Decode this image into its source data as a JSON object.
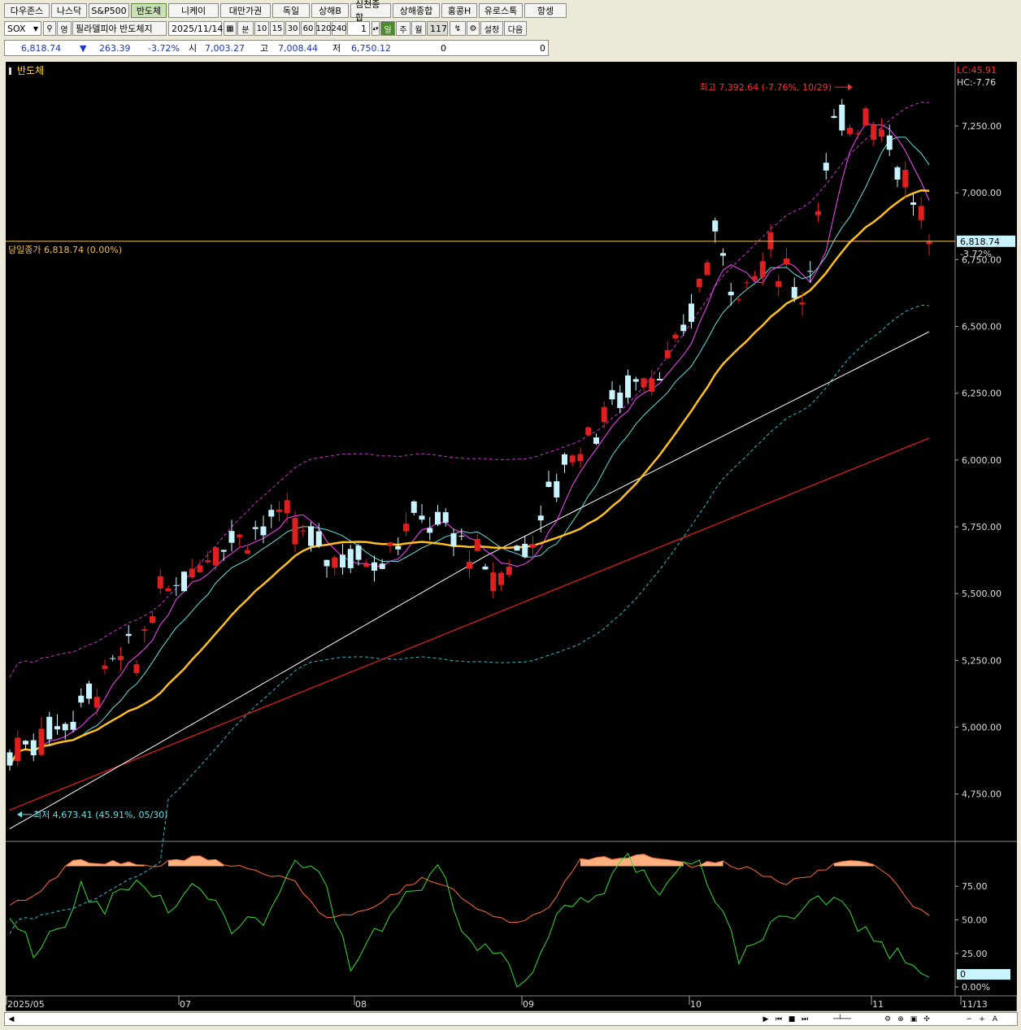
{
  "market_tabs": [
    "다우존스",
    "나스닥",
    "S&P500",
    "반도체",
    "니케이",
    "대만가권",
    "독일",
    "상해B",
    "심천종합",
    "상해종합",
    "홍콩H",
    "유로스톡",
    "항셍"
  ],
  "active_tab_index": 3,
  "toolbar": {
    "symbol": "SOX",
    "mode": "영",
    "name": "필라델피아 반도체지",
    "date": "2025/11/14",
    "minute_label": "분",
    "intervals": [
      "10",
      "15",
      "30",
      "60",
      "120",
      "240"
    ],
    "unit": "1",
    "day_label": "일",
    "week_label": "주",
    "month_label": "월",
    "count": "117",
    "settings_label": "설정",
    "next_label": "다음"
  },
  "quote": {
    "price": "6,818.74",
    "arrow": "▼",
    "change": "263.39",
    "pct": "-3.72%",
    "open_label": "시",
    "open": "7,003.27",
    "high_label": "고",
    "high": "7,008.44",
    "low_label": "저",
    "low": "6,750.12",
    "vol1": "0",
    "vol2": "0"
  },
  "chart_data": {
    "type": "candlestick",
    "title": "반도체",
    "top_right": [
      "LC:45.91",
      "HC:-7.76"
    ],
    "y_ticks": [
      "7,250.00",
      "7,000.00",
      "6,750.00",
      "6,500.00",
      "6,250.00",
      "6,000.00",
      "5,750.00",
      "5,500.00",
      "5,250.00",
      "5,000.00",
      "4,750.00"
    ],
    "y_tick_values": [
      7250,
      7000,
      6750,
      6500,
      6250,
      6000,
      5750,
      5500,
      5250,
      5000,
      4750
    ],
    "ylim": [
      4600,
      7460
    ],
    "x_labels": [
      "2025/05",
      "07",
      "08",
      "09",
      "10",
      "11",
      "11/13"
    ],
    "last_price_label": "6,818.74",
    "last_pct_label": "-3.72%",
    "close_line_label": "당일종가 6,818.74 (0.00%)",
    "high_annotation": "최고 7,392.64 (-7.76%, 10/29)",
    "low_annotation": "최저 4,673.41 (45.91%, 05/30)",
    "close_line_value": 6818.74,
    "high_value": 7392.64,
    "low_value": 4673.41,
    "oscillator": {
      "y_ticks": [
        "75.00",
        "50.00",
        "25.00",
        "0.00%"
      ],
      "y_tick_values": [
        75,
        50,
        25,
        0
      ],
      "ylim": [
        -3,
        103
      ],
      "current_label": "0"
    },
    "colors": {
      "up": "#e02020",
      "down": "#c8f4ff",
      "ma5": "#ff44ff",
      "ma10": "#66dddd",
      "ma20": "#ffbf1f",
      "ma60": "#ffffff",
      "ma120": "#ee2020",
      "band": "#cc33cc",
      "band_low": "#33bbcc",
      "osc1": "#ff6a3a",
      "osc2": "#33dd33"
    }
  }
}
